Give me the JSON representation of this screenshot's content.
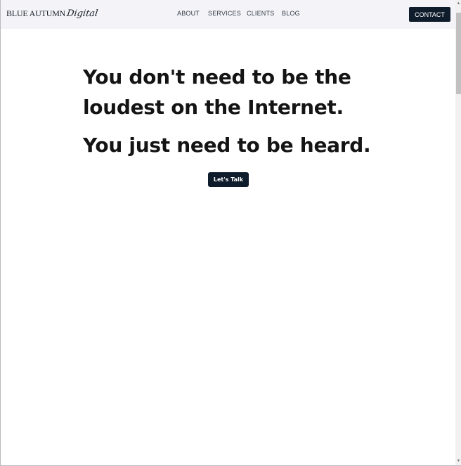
{
  "header": {
    "logo_main": "BLUE AUTUMN",
    "logo_script": "Digital",
    "nav": [
      {
        "label": "ABOUT"
      },
      {
        "label": "SERVICES"
      },
      {
        "label": "CLIENTS"
      },
      {
        "label": "BLOG"
      }
    ],
    "contact_label": "CONTACT"
  },
  "hero": {
    "line1": "You don't need to be the",
    "line2": "loudest on the Internet.",
    "line3": "You just need to be heard.",
    "cta_label": "Let's Talk"
  },
  "colors": {
    "header_bg": "#f3f3f8",
    "button_bg": "#0f1c2b",
    "text": "#141414"
  }
}
